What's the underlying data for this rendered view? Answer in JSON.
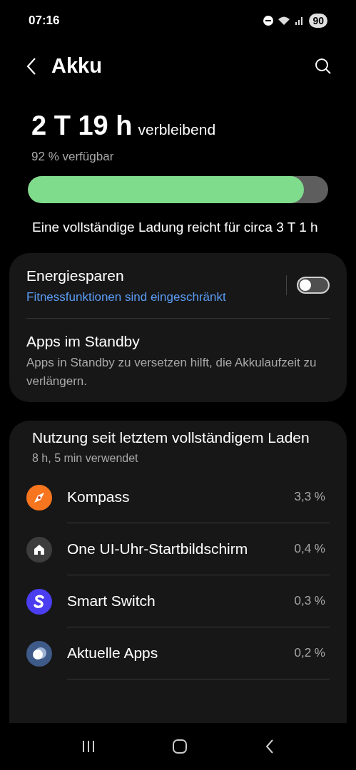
{
  "status_bar": {
    "time": "07:16",
    "battery": "90"
  },
  "header": {
    "title": "Akku"
  },
  "summary": {
    "remaining": "2 T 19 h",
    "remaining_suffix": "verbleibend",
    "available": "92 % verfügbar",
    "level": 0.92,
    "full_charge_note": "Eine vollständige Ladung reicht für circa 3 T 1 h"
  },
  "settings": [
    {
      "kind": "toggle",
      "title": "Energiesparen",
      "subtitle": "Fitnessfunktionen sind eingeschränkt",
      "on": false
    },
    {
      "kind": "link",
      "title": "Apps im Standby",
      "subtitle": "Apps in Standby zu versetzen hilft, die Akkulaufzeit zu verlängern."
    }
  ],
  "usage": {
    "title": "Nutzung seit letztem vollständigem Laden",
    "subtitle": "8 h, 5 min verwendet",
    "apps": [
      {
        "kind": "compass",
        "name": "Kompass",
        "share": "3,3 %"
      },
      {
        "kind": "home",
        "name": "One UI-Uhr-Startbildschirm",
        "share": "0,4 %"
      },
      {
        "kind": "switch",
        "name": "Smart Switch",
        "share": "0,3 %"
      },
      {
        "kind": "recent",
        "name": "Aktuelle Apps",
        "share": "0,2 %"
      }
    ]
  }
}
